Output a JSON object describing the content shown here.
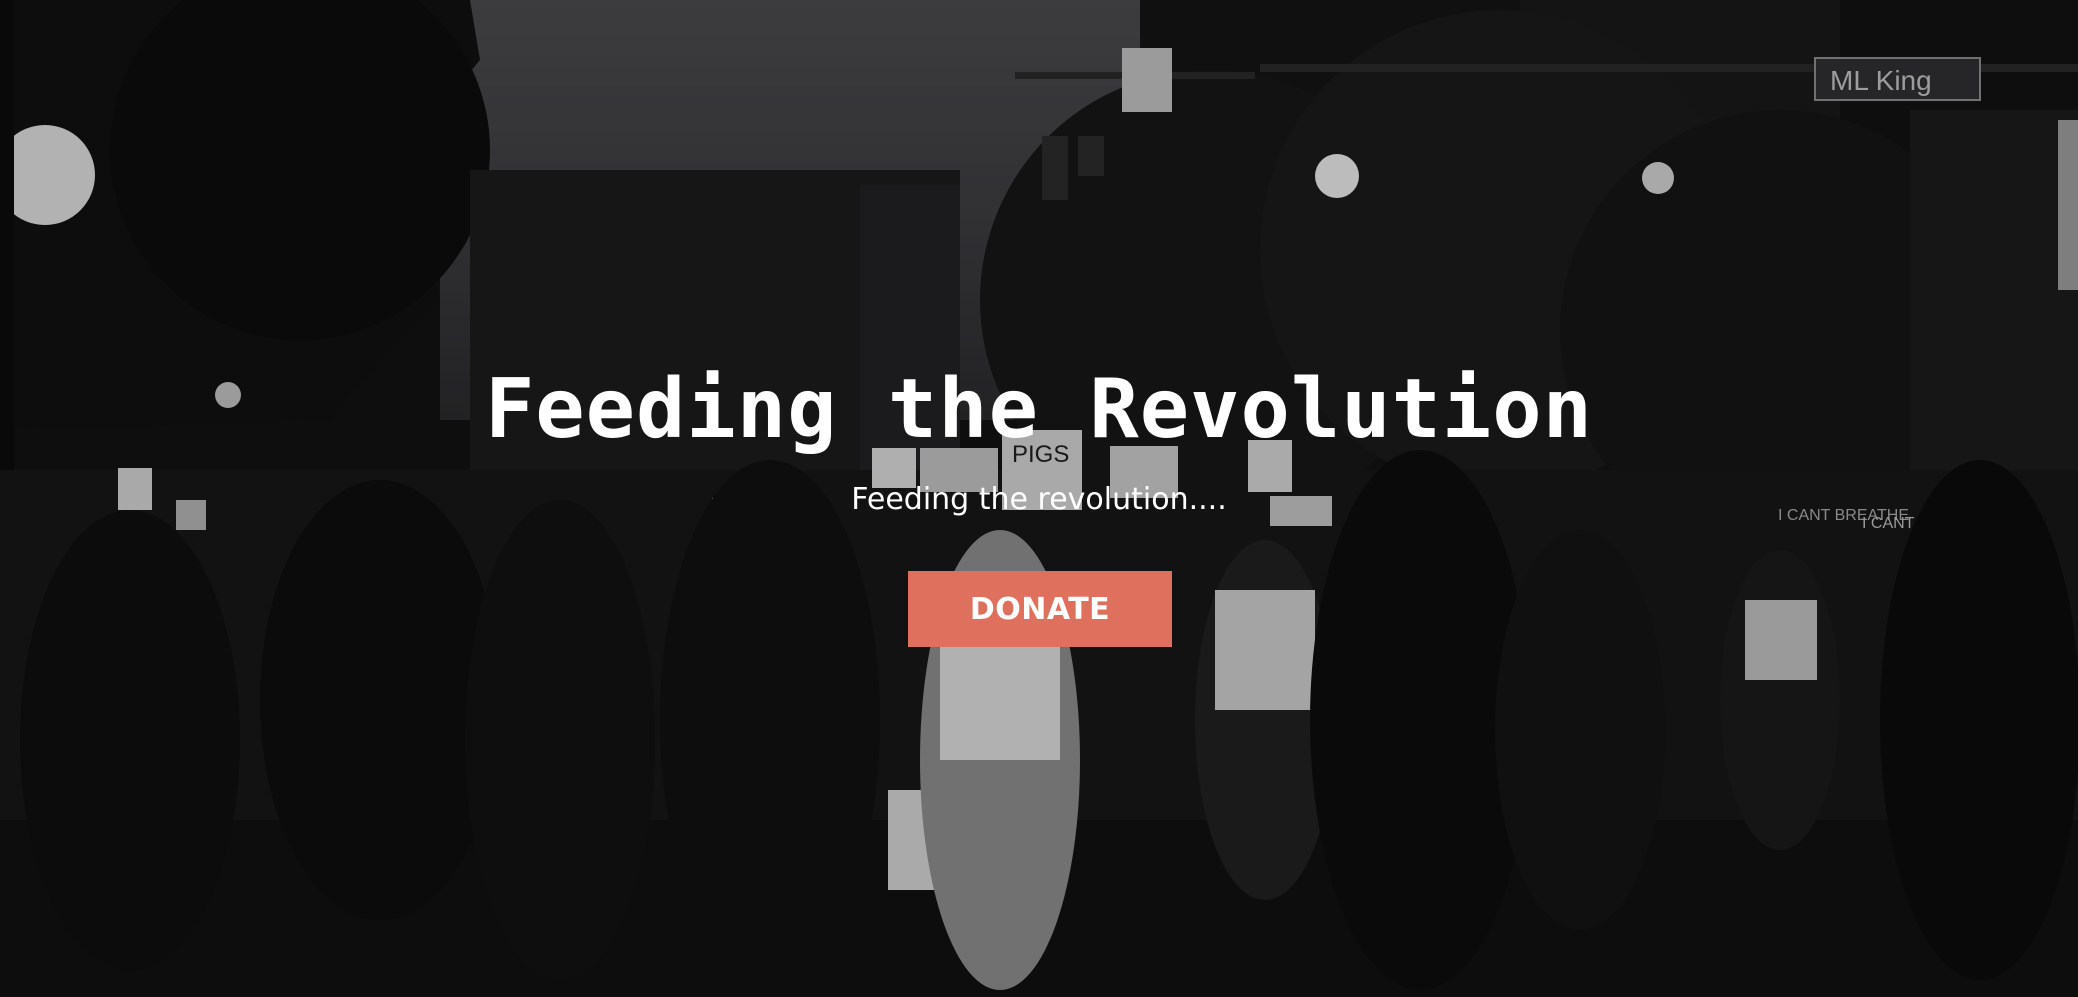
{
  "hero": {
    "title": "Feeding the Revolution",
    "subtitle": "Feeding the revolution....",
    "donate_label": "DONATE",
    "background_description_signs": [
      "ML King",
      "PIGS",
      "I CANT BREATHE",
      "I CANT"
    ],
    "colors": {
      "accent": "#e0705e",
      "text": "#ffffff",
      "overlay": "#121213"
    }
  }
}
